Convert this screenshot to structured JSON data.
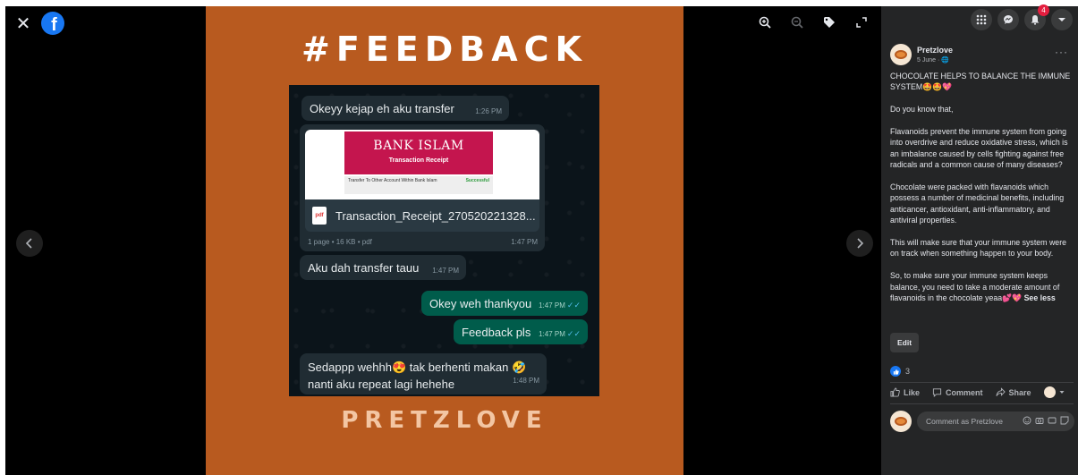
{
  "viewer": {
    "poster": {
      "hashtag": "#FEEDBACK",
      "brand": "PRETZLOVE"
    },
    "chat": {
      "msg1": {
        "text": "Okeyy kejap eh aku transfer",
        "time": "1:26 PM"
      },
      "receipt": {
        "bank": "BANK ISLAM",
        "subtitle": "Transaction Receipt",
        "row_label": "Transfer To Other Account Within Bank Islam",
        "status": "Successful",
        "pdf_icon": "pdf",
        "file_name": "Transaction_Receipt_270520221328...",
        "meta": "1 page • 16 KB • pdf",
        "time": "1:47 PM"
      },
      "msg3": {
        "text": "Aku dah transfer tauu",
        "time": "1:47 PM"
      },
      "msg4": {
        "text": "Okey weh thankyou",
        "time": "1:47 PM"
      },
      "msg5": {
        "text": "Feedback pls",
        "time": "1:47 PM"
      },
      "msg6": {
        "line1": "Sedappp wehhh😍 tak berhenti makan 🤣",
        "line2": "nanti aku repeat lagi hehehe",
        "time": "1:48 PM"
      }
    }
  },
  "topbar": {
    "notification_count": "4"
  },
  "post": {
    "author": "Pretzlove",
    "date": "5 June · 🌐",
    "paragraphs": [
      "CHOCOLATE HELPS TO BALANCE THE IMMUNE SYSTEM🤩🤩💖",
      "Do you know that,",
      "Flavanoids prevent the immune system from going into overdrive and reduce oxidative stress, which is an imbalance caused by cells fighting against free radicals and a common cause of many diseases?",
      "Chocolate were packed with flavanoids which possess a number of medicinal benefits, including anticancer, antioxidant, anti-inflammatory, and antiviral properties.",
      "This will make sure that your immune system were on track when something happen to your body.",
      "So, to make sure your immune system keeps balance, you need to take a moderate amount of flavanoids in the chocolate yeaa💕💖"
    ],
    "see_less": "See less",
    "edit_label": "Edit",
    "reaction_count": "3",
    "actions": {
      "like": "Like",
      "comment": "Comment",
      "share": "Share"
    },
    "comment_placeholder": "Comment as Pretzlove"
  }
}
